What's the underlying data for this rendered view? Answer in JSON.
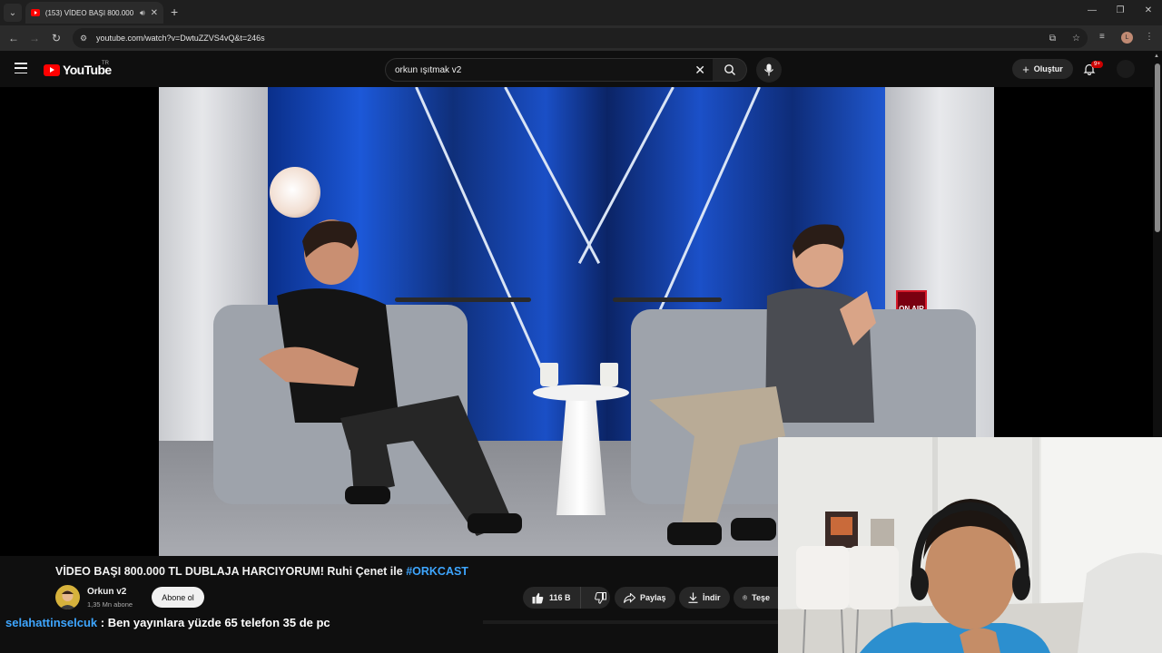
{
  "browser": {
    "tab_title": "(153) VİDEO BAŞI 800.000 TL DUBLAJA HARCIYORUM",
    "url": "youtube.com/watch?v=DwtuZZVS4vQ&t=246s",
    "profile_initial": "L",
    "icons": [
      "tab-search-icon",
      "youtube-favicon-icon",
      "speaker-icon",
      "close-icon",
      "plus-icon",
      "minimize-icon",
      "restore-icon",
      "back-arrow-icon",
      "forward-arrow-icon",
      "reload-icon",
      "site-info-icon",
      "install-app-icon",
      "bookmark-star-icon",
      "media-controls-icon",
      "kebab-menu-icon"
    ]
  },
  "masthead": {
    "logo_text": "YouTube",
    "region": "TR",
    "search_value": "orkun ışıtmak v2",
    "create_label": "Oluştur",
    "notification_count": "9+"
  },
  "video": {
    "title_main": "VİDEO BAŞI 800.000 TL DUBLAJA HARCIYORUM! Ruhi Çenet ile ",
    "title_hashtag": "#ORKCAST",
    "on_air_sign": "ON AIR"
  },
  "channel": {
    "name": "Orkun v2",
    "subscribers": "1,35 Mn abone",
    "subscribe_label": "Abone ol"
  },
  "actions": {
    "like_count": "116 B",
    "share_label": "Paylaş",
    "download_label": "İndir",
    "thanks_label": "Teşe"
  },
  "chat": {
    "username": "selahattinselcuk",
    "separator": " : ",
    "message": "Ben yayınlara yüzde 65 telefon 35 de pc"
  },
  "colors": {
    "page_bg": "#0f0f0f",
    "youtube_red": "#ff0000",
    "link_blue": "#3ea6ff",
    "pill_bg": "#272727"
  }
}
